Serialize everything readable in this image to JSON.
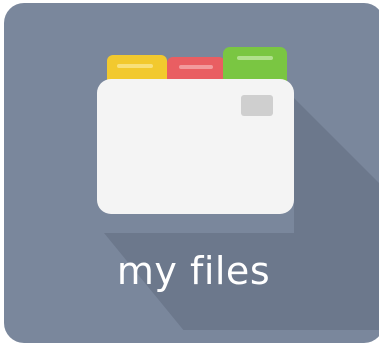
{
  "tile": {
    "label": "my files",
    "icon": "folder-tabs-icon",
    "colors": {
      "background": "#7a879c",
      "shadow": "#6a768a",
      "folder_body": "#f4f4f4",
      "tab_yellow": "#f2c92e",
      "tab_red": "#e95e62",
      "tab_green": "#7ac642",
      "label_text": "#ffffff"
    }
  }
}
